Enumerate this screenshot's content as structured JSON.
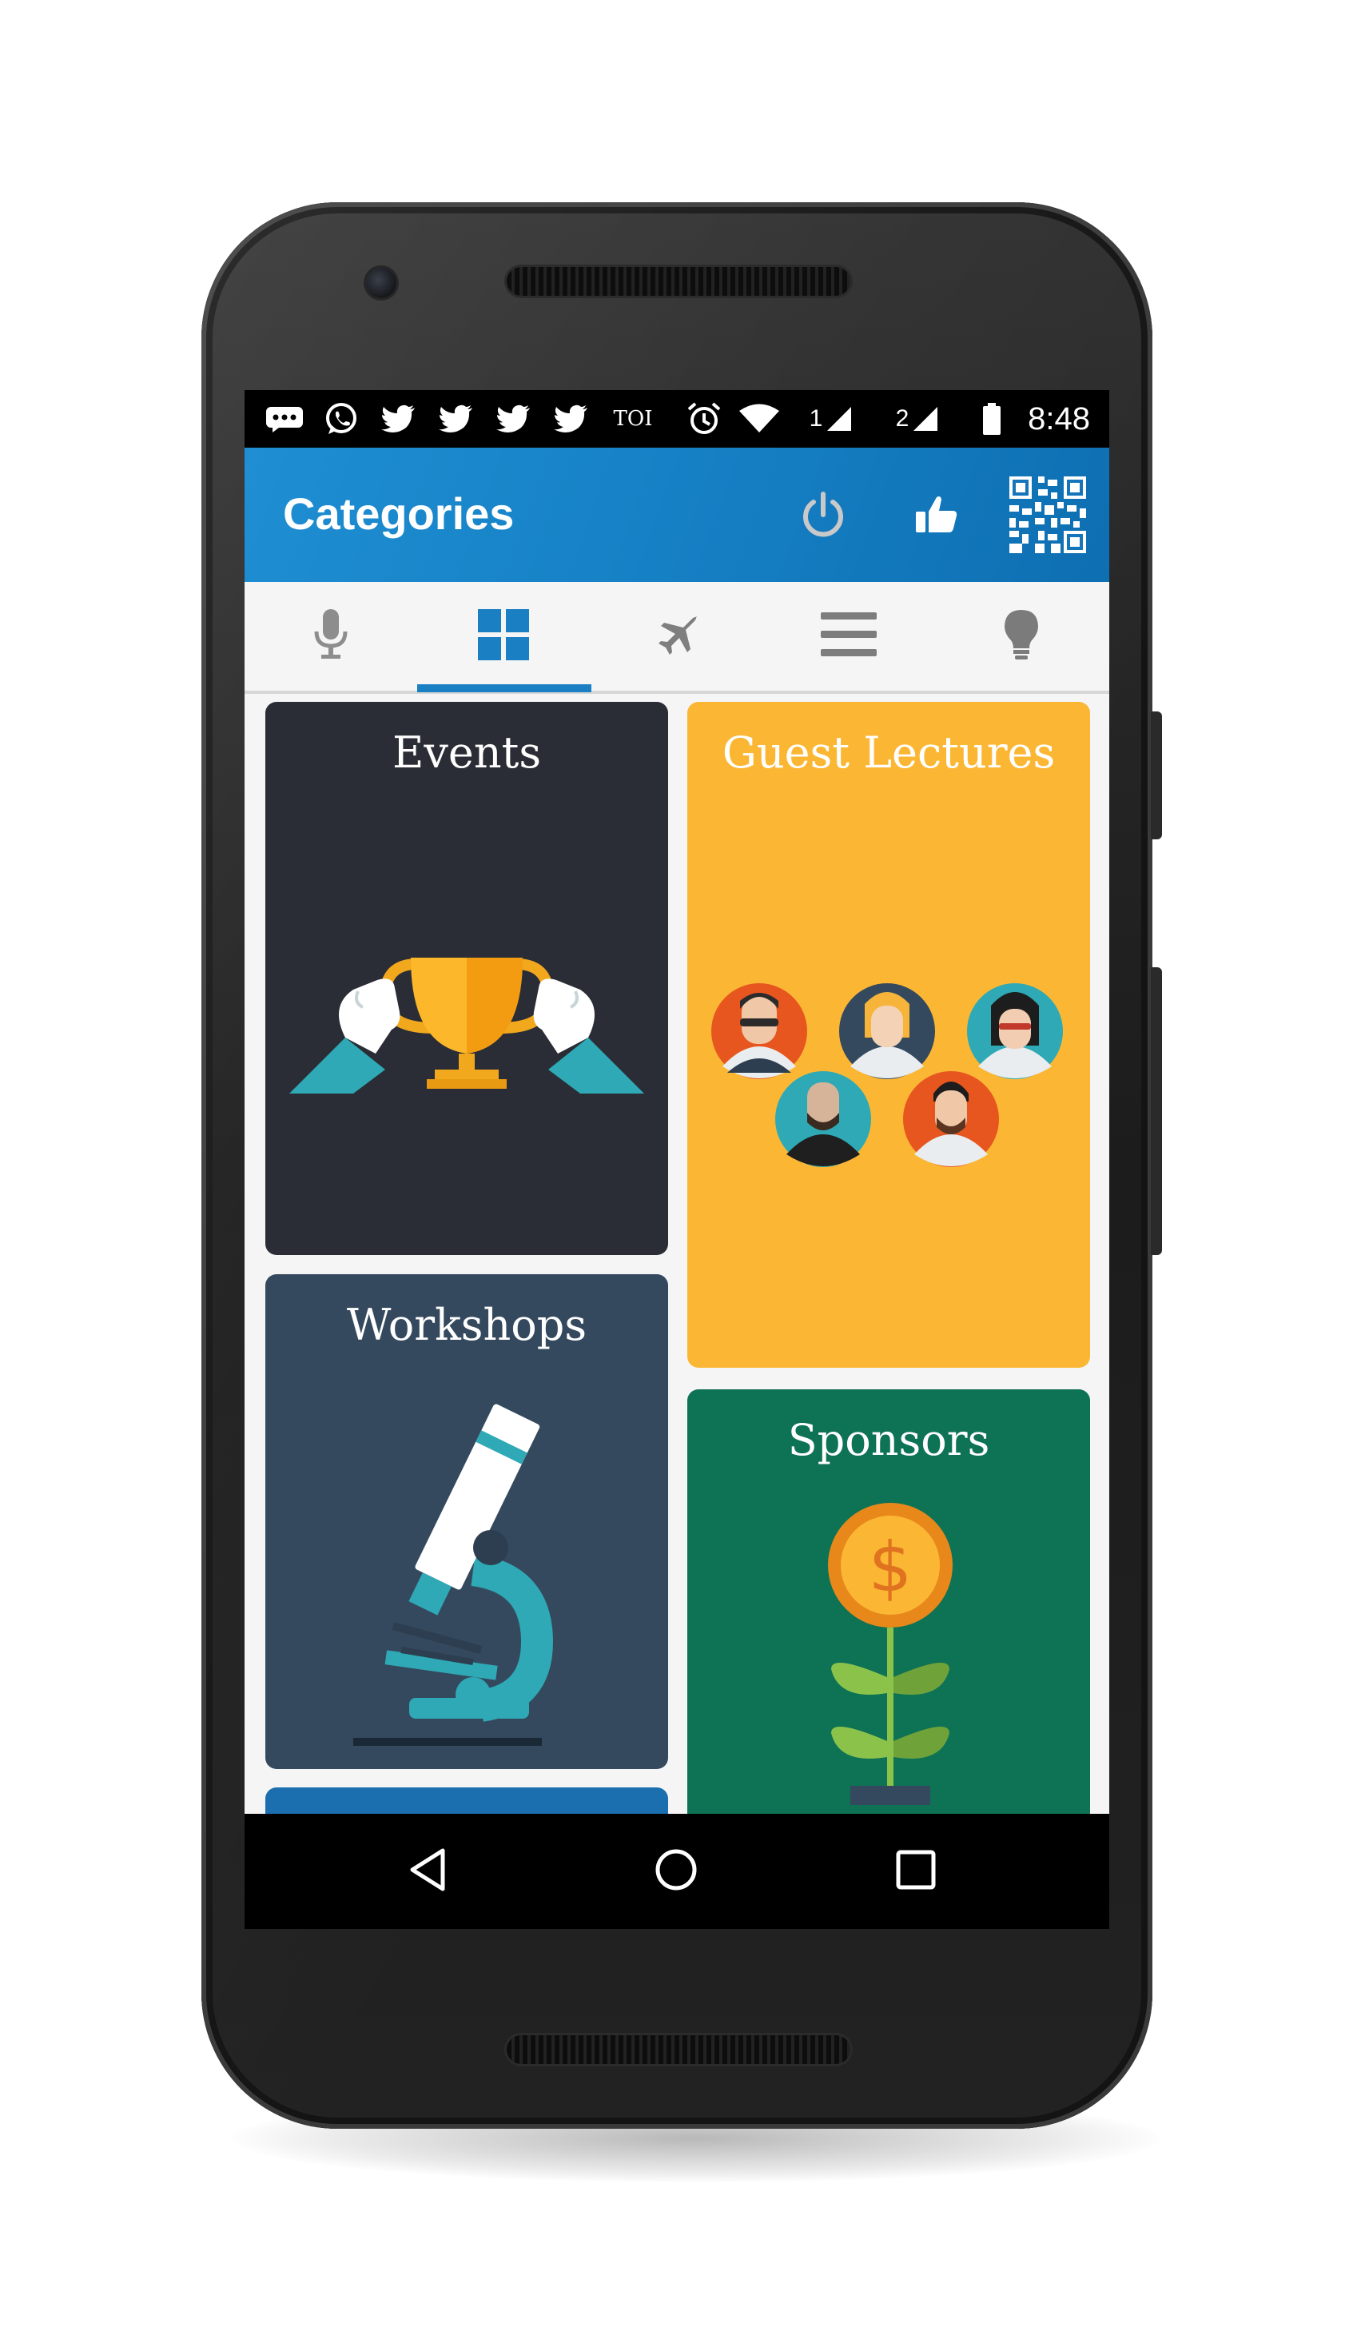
{
  "status_bar": {
    "time": "8:48",
    "notification_text": "TOI",
    "sim1_label": "1",
    "sim2_label": "2",
    "icons": [
      "message-icon",
      "whatsapp-icon",
      "twitter-icon",
      "twitter-icon",
      "twitter-icon",
      "twitter-icon",
      "toi-icon",
      "alarm-icon",
      "wifi-icon",
      "signal-icon",
      "signal-icon",
      "battery-icon"
    ]
  },
  "app_bar": {
    "title": "Categories",
    "actions": [
      "power-icon",
      "thumbs-up-icon",
      "qr-code-icon"
    ],
    "color": "#1680c5"
  },
  "tabs": {
    "items": [
      "microphone-icon",
      "grid-icon",
      "airplane-icon",
      "list-icon",
      "lightbulb-icon"
    ],
    "selected_index": 1,
    "accent": "#1b7fc4"
  },
  "cards": {
    "events": {
      "title": "Events",
      "color": "#2a2d35",
      "icon": "trophy-icon"
    },
    "guest_lectures": {
      "title": "Guest Lectures",
      "color": "#fbb734",
      "icon": "people-avatars-icon"
    },
    "workshops": {
      "title": "Workshops",
      "color": "#34495e",
      "icon": "microscope-icon"
    },
    "sponsors": {
      "title": "Sponsors",
      "color": "#0e7255",
      "icon": "money-plant-icon"
    }
  },
  "nav_bar": {
    "buttons": [
      "back-icon",
      "home-icon",
      "recents-icon"
    ]
  }
}
